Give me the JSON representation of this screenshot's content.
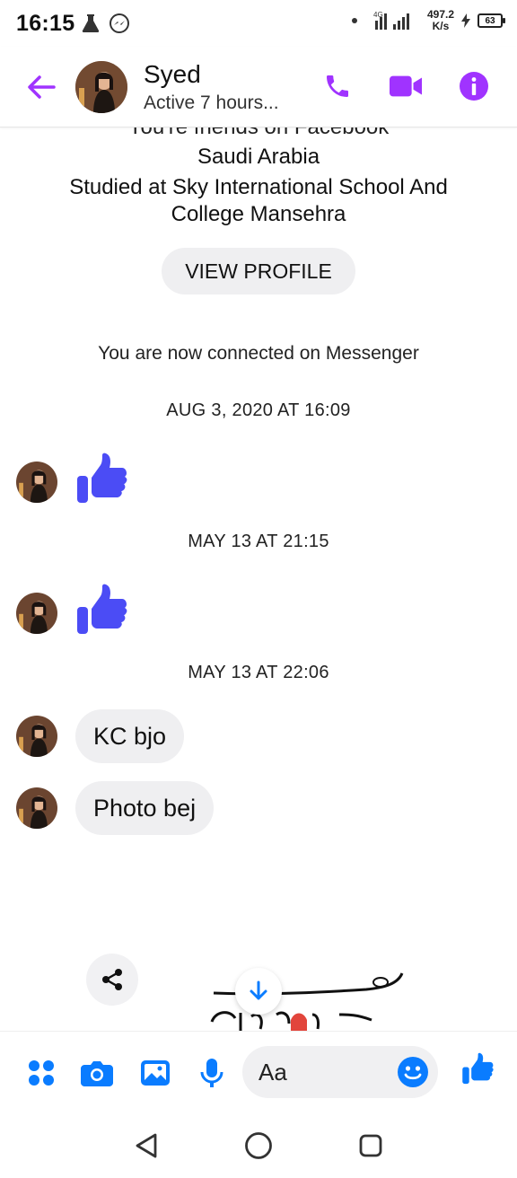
{
  "status_bar": {
    "time": "16:15",
    "network_type": "4G",
    "speed_value": "497.2",
    "speed_unit": "K/s",
    "battery": "63"
  },
  "header": {
    "name": "Syed",
    "status": "Active 7 hours..."
  },
  "profile_intro": {
    "friends_line": "You're friends on Facebook",
    "location": "Saudi Arabia",
    "education": "Studied at Sky International School And College Mansehra",
    "view_profile_label": "VIEW PROFILE"
  },
  "conversation": {
    "connected_text": "You are now connected on Messenger",
    "timestamps": [
      "AUG 3, 2020 AT 16:09",
      "MAY 13 AT 21:15",
      "MAY 13 AT 22:06"
    ],
    "messages": [
      "KC bjo",
      "Photo bej"
    ]
  },
  "composer": {
    "placeholder": "Aa"
  },
  "colors": {
    "accent": "#a033ff",
    "like_blue": "#4b4cf5",
    "composer_blue": "#0a7cff",
    "bubble_gray": "#efeff1"
  },
  "icons": {
    "header": [
      "back-arrow-icon",
      "phone-icon",
      "video-icon",
      "info-icon"
    ],
    "composer": [
      "apps-icon",
      "camera-icon",
      "gallery-icon",
      "microphone-icon",
      "emoji-icon",
      "like-icon"
    ],
    "nav": [
      "back-nav-icon",
      "home-nav-icon",
      "recents-nav-icon"
    ]
  }
}
